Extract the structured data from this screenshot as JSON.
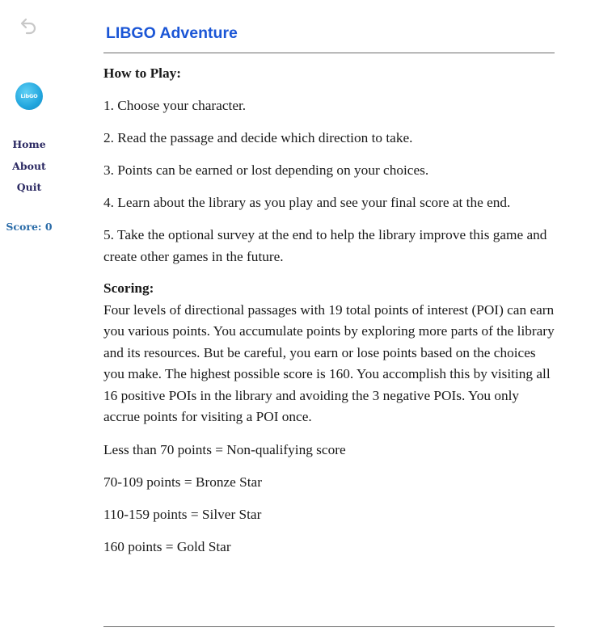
{
  "sidebar": {
    "back_icon": "undo-arrow-icon",
    "logo_text": "LibGO",
    "nav": [
      {
        "label": "Home"
      },
      {
        "label": "About"
      },
      {
        "label": "Quit"
      }
    ],
    "score_text": "Score: 0"
  },
  "header": {
    "title": "LIBGO Adventure",
    "title_color": "#1b56d6"
  },
  "how_to_play": {
    "heading": "How to Play:",
    "steps": [
      "1. Choose your character.",
      "2. Read the passage and decide which direction to take.",
      "3. Points can be earned or lost depending on your choices.",
      "4. Learn about the library as you play and see your final score at the end.",
      "5. Take the optional survey at the end to help the library improve this game and create other games in the future."
    ]
  },
  "scoring": {
    "heading": "Scoring:",
    "description": "Four levels of directional passages with 19 total points of interest (POI) can earn you various points. You accumulate points by exploring more parts of the library and its resources. But be careful, you earn or lose points based on the choices you make. The highest possible score is 160. You accomplish this by visiting all 16 positive POIs in the library and avoiding the 3 negative POIs. You only accrue points for visiting a POI once.",
    "levels": [
      "Less than 70 points = Non-qualifying score",
      "70-109 points = Bronze Star",
      "110-159 points = Silver Star",
      "160 points = Gold Star"
    ]
  },
  "colors": {
    "nav_text": "#2c2a63",
    "score_text": "#2b6ca8",
    "logo": "#22a6de",
    "rule": "#6b6b6b"
  }
}
